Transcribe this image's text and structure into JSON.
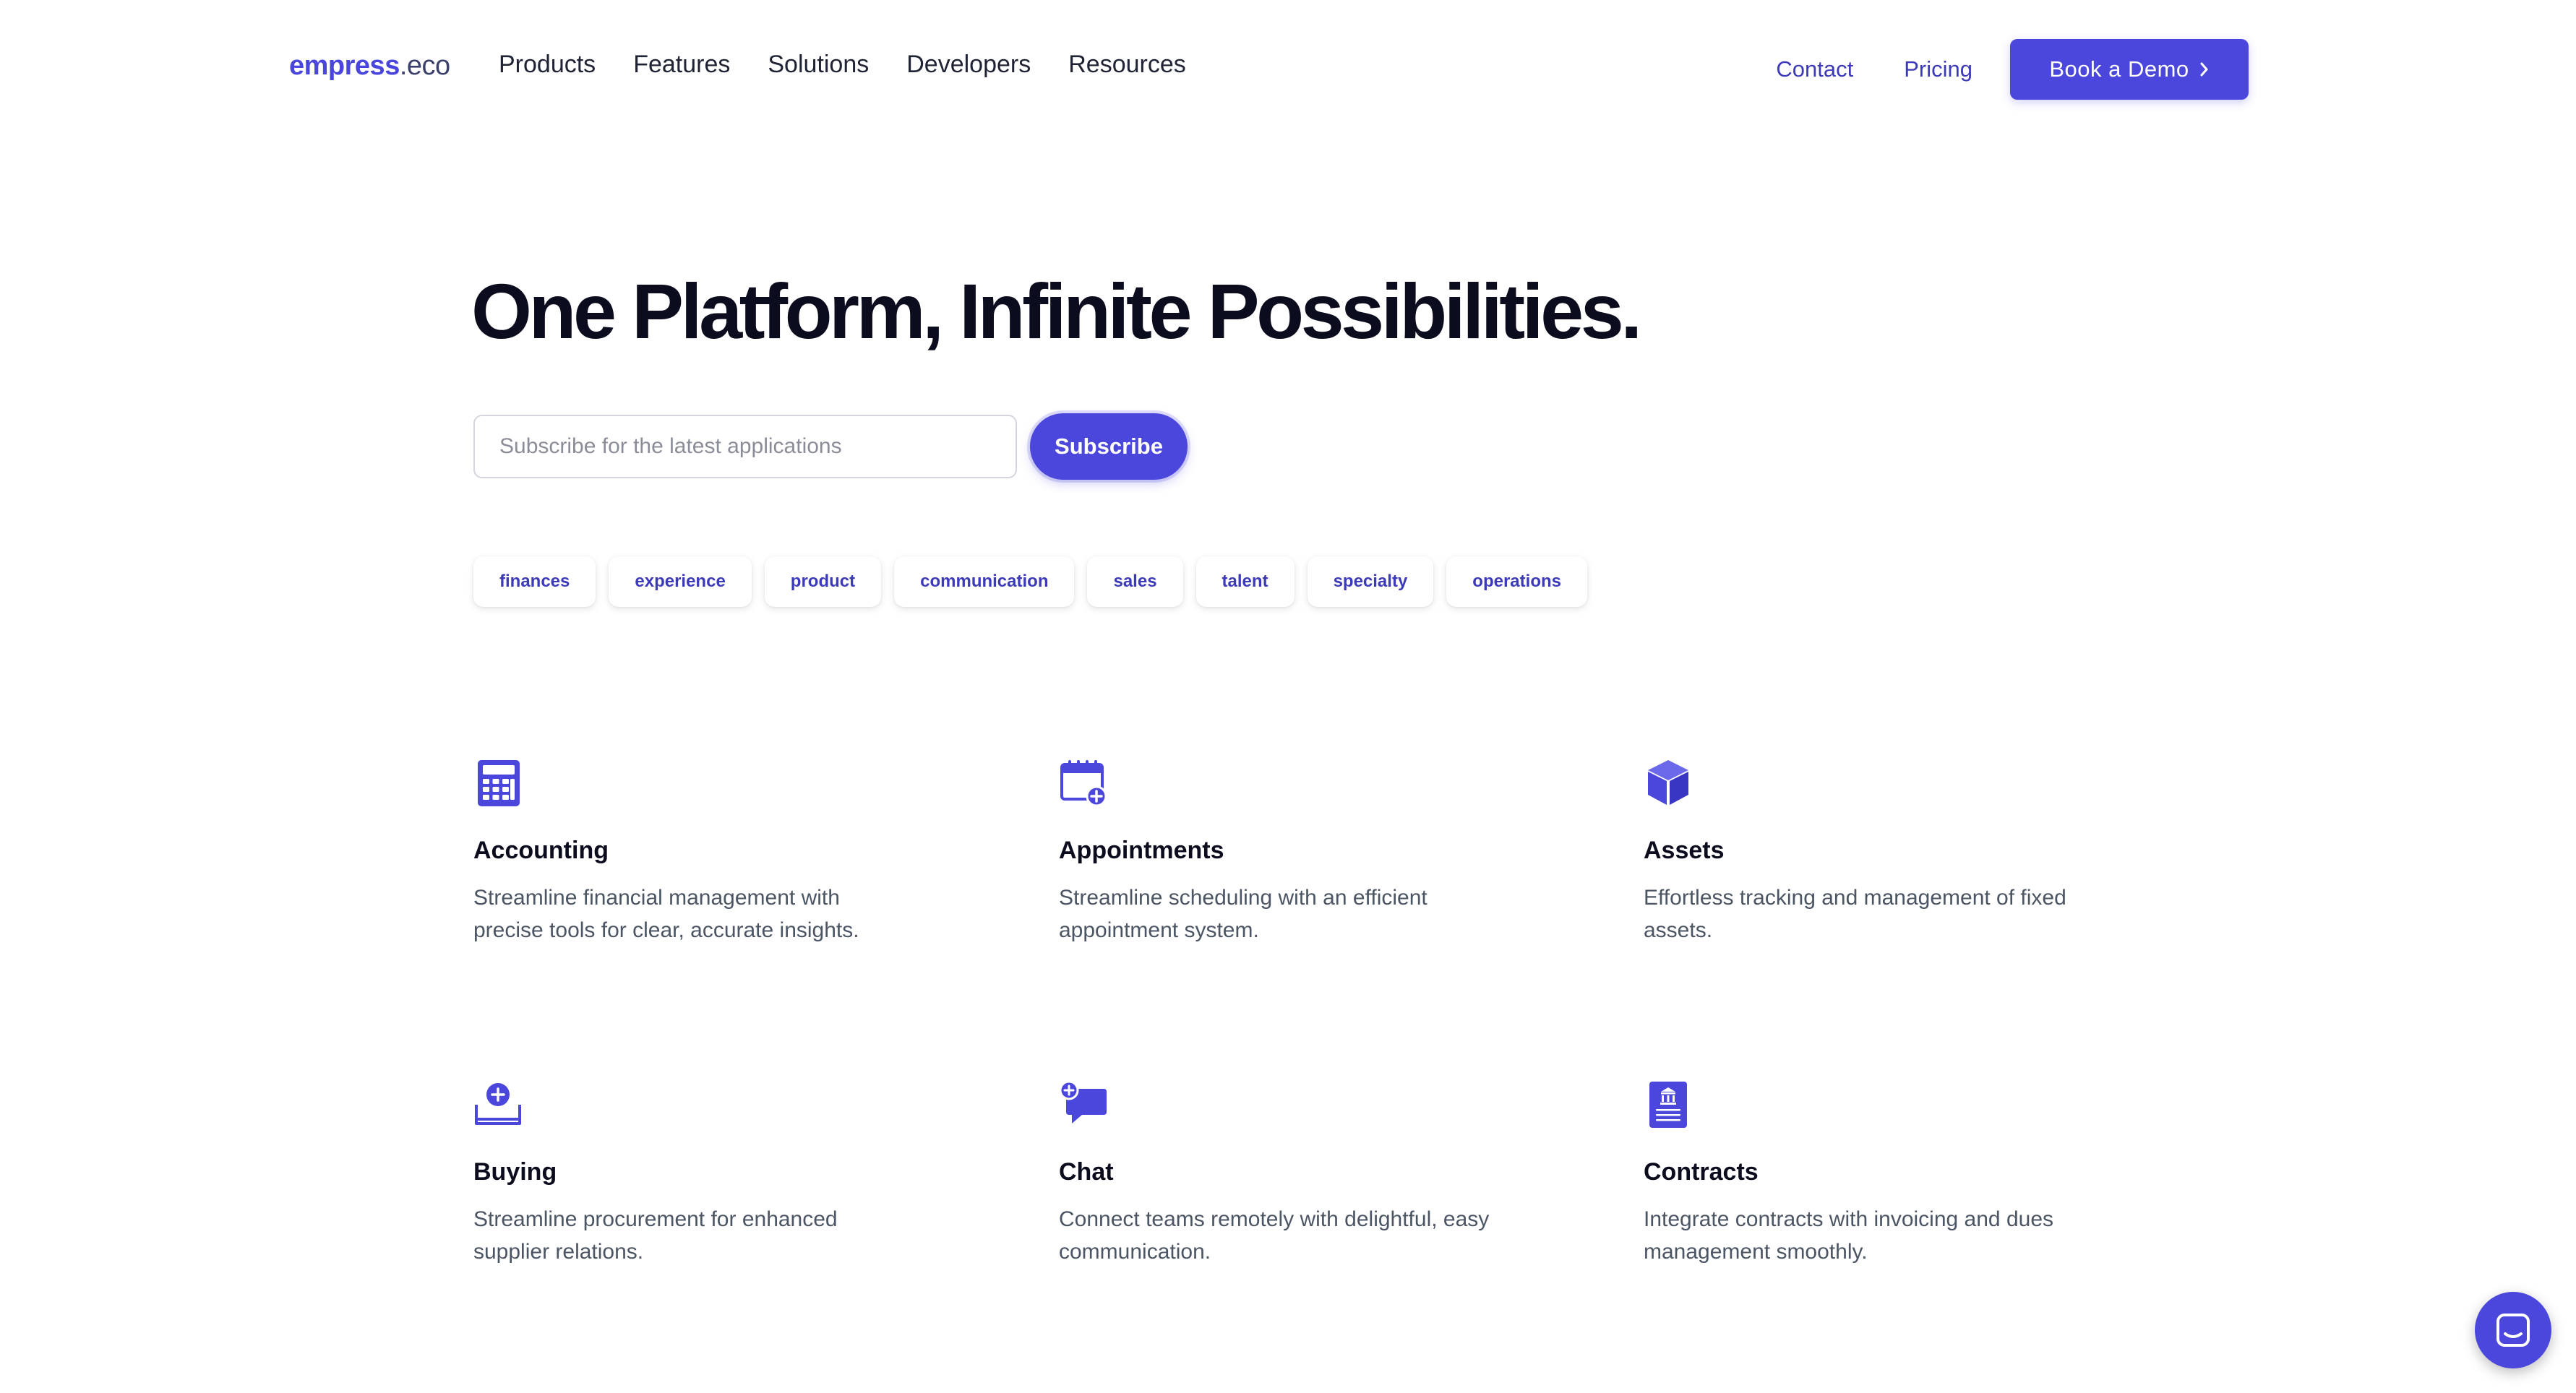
{
  "header": {
    "logo_brand": "empress",
    "logo_tld": ".eco",
    "nav": [
      "Products",
      "Features",
      "Solutions",
      "Developers",
      "Resources"
    ],
    "contact": "Contact",
    "pricing": "Pricing",
    "demo_button": "Book a Demo"
  },
  "hero": {
    "title": "One Platform, Infinite Possibilities.",
    "subscribe_placeholder": "Subscribe for the latest applications",
    "subscribe_value": "",
    "subscribe_button": "Subscribe"
  },
  "tags": [
    "finances",
    "experience",
    "product",
    "communication",
    "sales",
    "talent",
    "specialty",
    "operations"
  ],
  "features": [
    {
      "icon": "calculator-icon",
      "title": "Accounting",
      "description": "Streamline financial management with precise tools for clear, accurate insights."
    },
    {
      "icon": "calendar-add-icon",
      "title": "Appointments",
      "description": "Streamline scheduling with an efficient appointment system."
    },
    {
      "icon": "cube-icon",
      "title": "Assets",
      "description": "Effortless tracking and management of fixed assets."
    },
    {
      "icon": "inbox-add-icon",
      "title": "Buying",
      "description": "Streamline procurement for enhanced supplier relations."
    },
    {
      "icon": "chat-add-icon",
      "title": "Chat",
      "description": "Connect teams remotely with delightful, easy communication."
    },
    {
      "icon": "contract-document-icon",
      "title": "Contracts",
      "description": "Integrate contracts with invoicing and dues management smoothly."
    }
  ],
  "chat_widget": {
    "icon": "chat-widget-icon"
  },
  "colors": {
    "accent": "#4b47dc",
    "link": "#3c3ab8",
    "heading": "#0b0c1d",
    "body_text": "#4b5563"
  }
}
